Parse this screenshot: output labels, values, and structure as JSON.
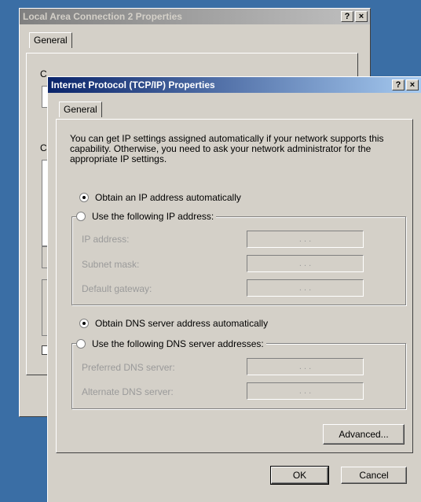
{
  "back_window": {
    "title": "Local Area Connection 2 Properties",
    "help_btn": "?",
    "close_btn": "×",
    "tab_general": "General",
    "frag1": "C",
    "frag2": "C"
  },
  "front_window": {
    "title": "Internet Protocol (TCP/IP) Properties",
    "help_btn": "?",
    "close_btn": "×",
    "tab_general": "General",
    "description": "You can get IP settings assigned automatically if your network supports this capability. Otherwise, you need to ask your network administrator for the appropriate IP settings.",
    "ip_auto": "Obtain an IP address automatically",
    "ip_manual": "Use the following IP address:",
    "ip_label": "IP address:",
    "subnet_label": "Subnet mask:",
    "gateway_label": "Default gateway:",
    "dns_auto": "Obtain DNS server address automatically",
    "dns_manual": "Use the following DNS server addresses:",
    "pref_dns_label": "Preferred DNS server:",
    "alt_dns_label": "Alternate DNS server:",
    "ip_dots": ".   .   .",
    "advanced": "Advanced...",
    "ok": "OK",
    "cancel": "Cancel"
  }
}
